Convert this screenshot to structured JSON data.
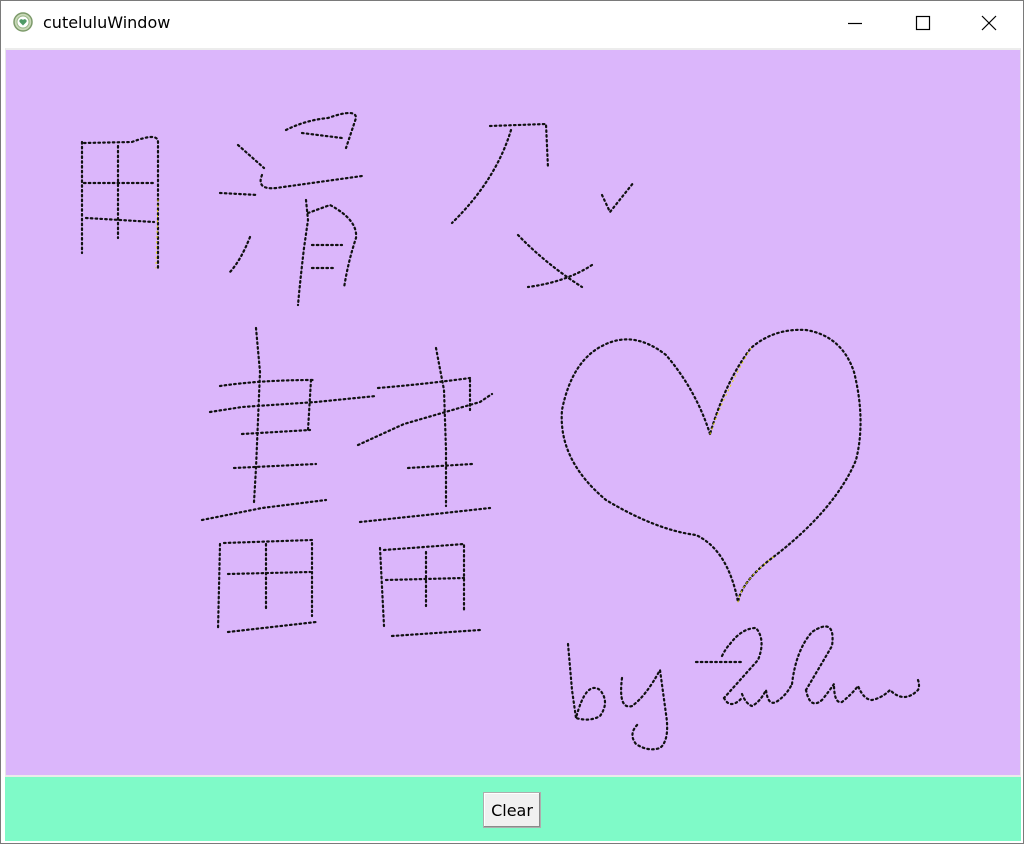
{
  "window": {
    "title": "cuteluluWindow",
    "controls": {
      "minimize": "minimize-icon",
      "maximize": "maximize-icon",
      "close": "close-icon"
    }
  },
  "canvas": {
    "background": "#dbb6fb",
    "stroke_color": "#111111",
    "handwriting": "用滑又 畫畫 by Lulu"
  },
  "bottom_bar": {
    "background": "#7ffac8",
    "clear_label": "Clear"
  }
}
